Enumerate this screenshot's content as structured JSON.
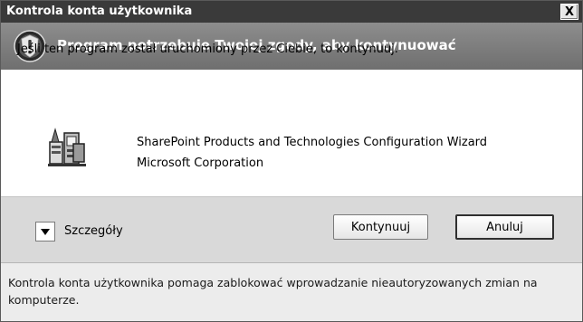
{
  "window": {
    "title": "Kontrola konta użytkownika",
    "close_label": "X"
  },
  "banner": {
    "headline": "Program potrzebuje Twojej zgody, aby kontynuować",
    "icon": "shield-icon"
  },
  "content": {
    "intro": "Jeśli ten program został uruchomiony przez Ciebie, to kontynuuj.",
    "program_name": "SharePoint Products and Technologies Configuration Wizard",
    "publisher": "Microsoft Corporation",
    "program_icon": "installer-icon"
  },
  "buttons": {
    "details_label": "Szczegóły",
    "continue_label": "Kontynuuj",
    "cancel_label": "Anuluj"
  },
  "footer": {
    "note": "Kontrola konta użytkownika pomaga zablokować wprowadzanie nieautoryzowanych zmian na komputerze."
  },
  "colors": {
    "titlebar": "#3a3a3a",
    "banner": "#7a7a7a",
    "buttonbar": "#d9d9d9",
    "footer": "#ececec"
  }
}
